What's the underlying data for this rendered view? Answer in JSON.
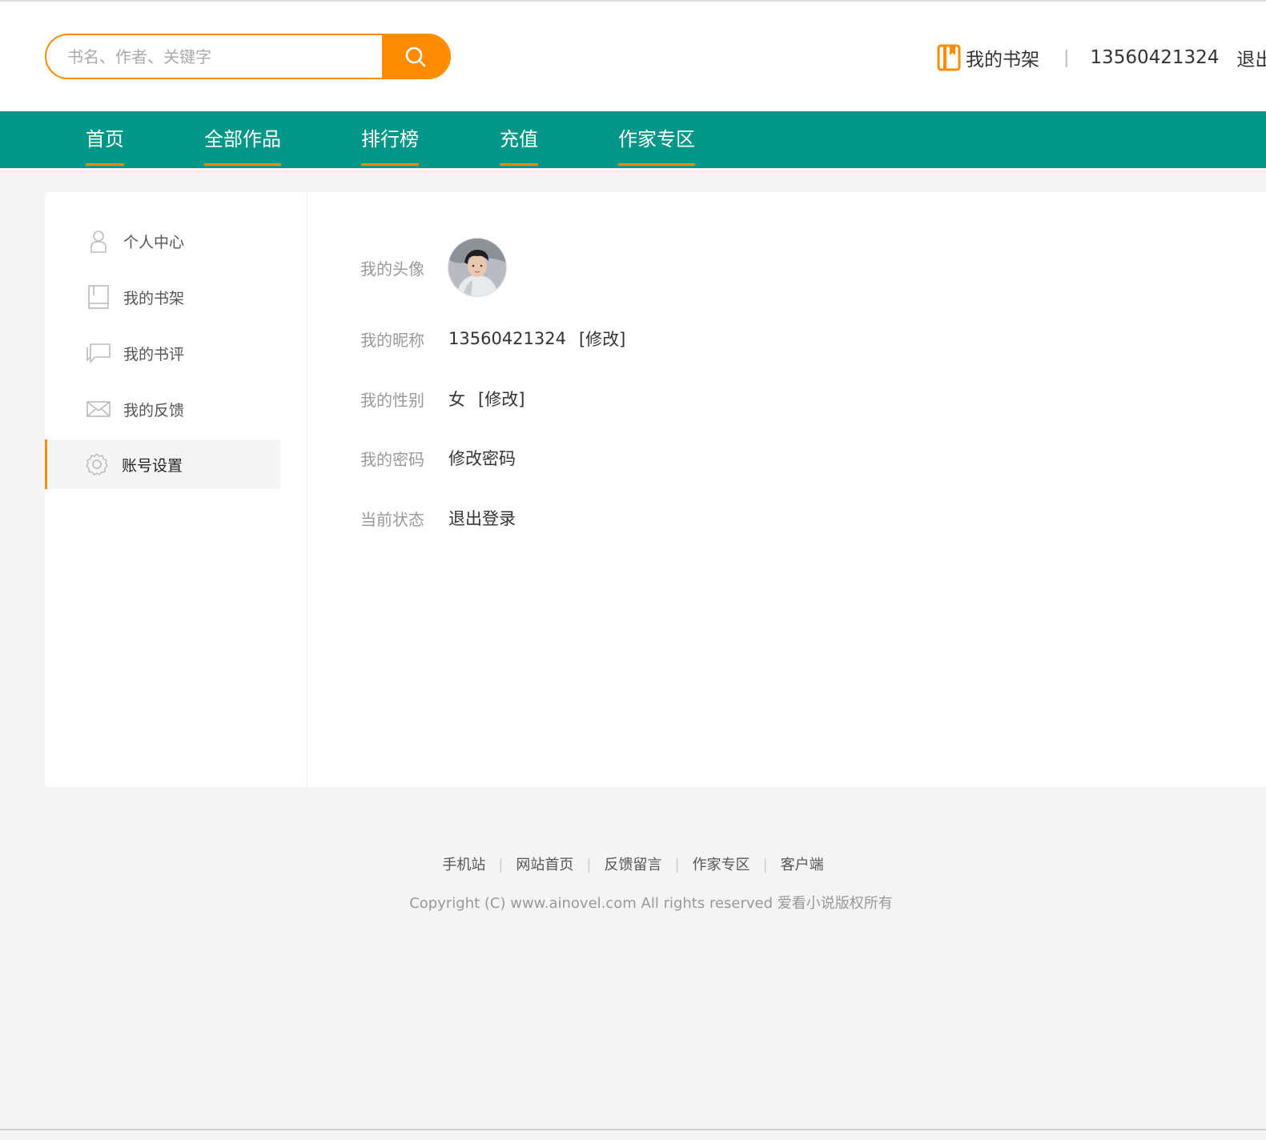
{
  "header": {
    "search_placeholder": "书名、作者、关键字",
    "shelf_label": "我的书架",
    "username": "13560421324",
    "logout_label": "退出"
  },
  "nav": {
    "items": [
      {
        "label": "首页"
      },
      {
        "label": "全部作品"
      },
      {
        "label": "排行榜"
      },
      {
        "label": "充值"
      },
      {
        "label": "作家专区"
      }
    ]
  },
  "sidebar": {
    "items": [
      {
        "label": "个人中心",
        "icon": "user-icon"
      },
      {
        "label": "我的书架",
        "icon": "book-icon"
      },
      {
        "label": "我的书评",
        "icon": "comment-icon"
      },
      {
        "label": "我的反馈",
        "icon": "mail-icon"
      },
      {
        "label": "账号设置",
        "icon": "gear-icon",
        "active": true
      }
    ]
  },
  "profile": {
    "avatar_label": "我的头像",
    "nickname_label": "我的昵称",
    "nickname": "13560421324",
    "nickname_edit": "[修改]",
    "gender_label": "我的性别",
    "gender": "女",
    "gender_edit": "[修改]",
    "password_label": "我的密码",
    "password_action": "修改密码",
    "status_label": "当前状态",
    "status_action": "退出登录"
  },
  "footer": {
    "links": [
      "手机站",
      "网站首页",
      "反馈留言",
      "作家专区",
      "客户端"
    ],
    "copyright": "Copyright (C) www.ainovel.com All rights reserved   爱看小说版权所有"
  },
  "colors": {
    "accent": "#ff8c00",
    "nav_bg": "#009688",
    "page_bg": "#f4f4f4"
  }
}
